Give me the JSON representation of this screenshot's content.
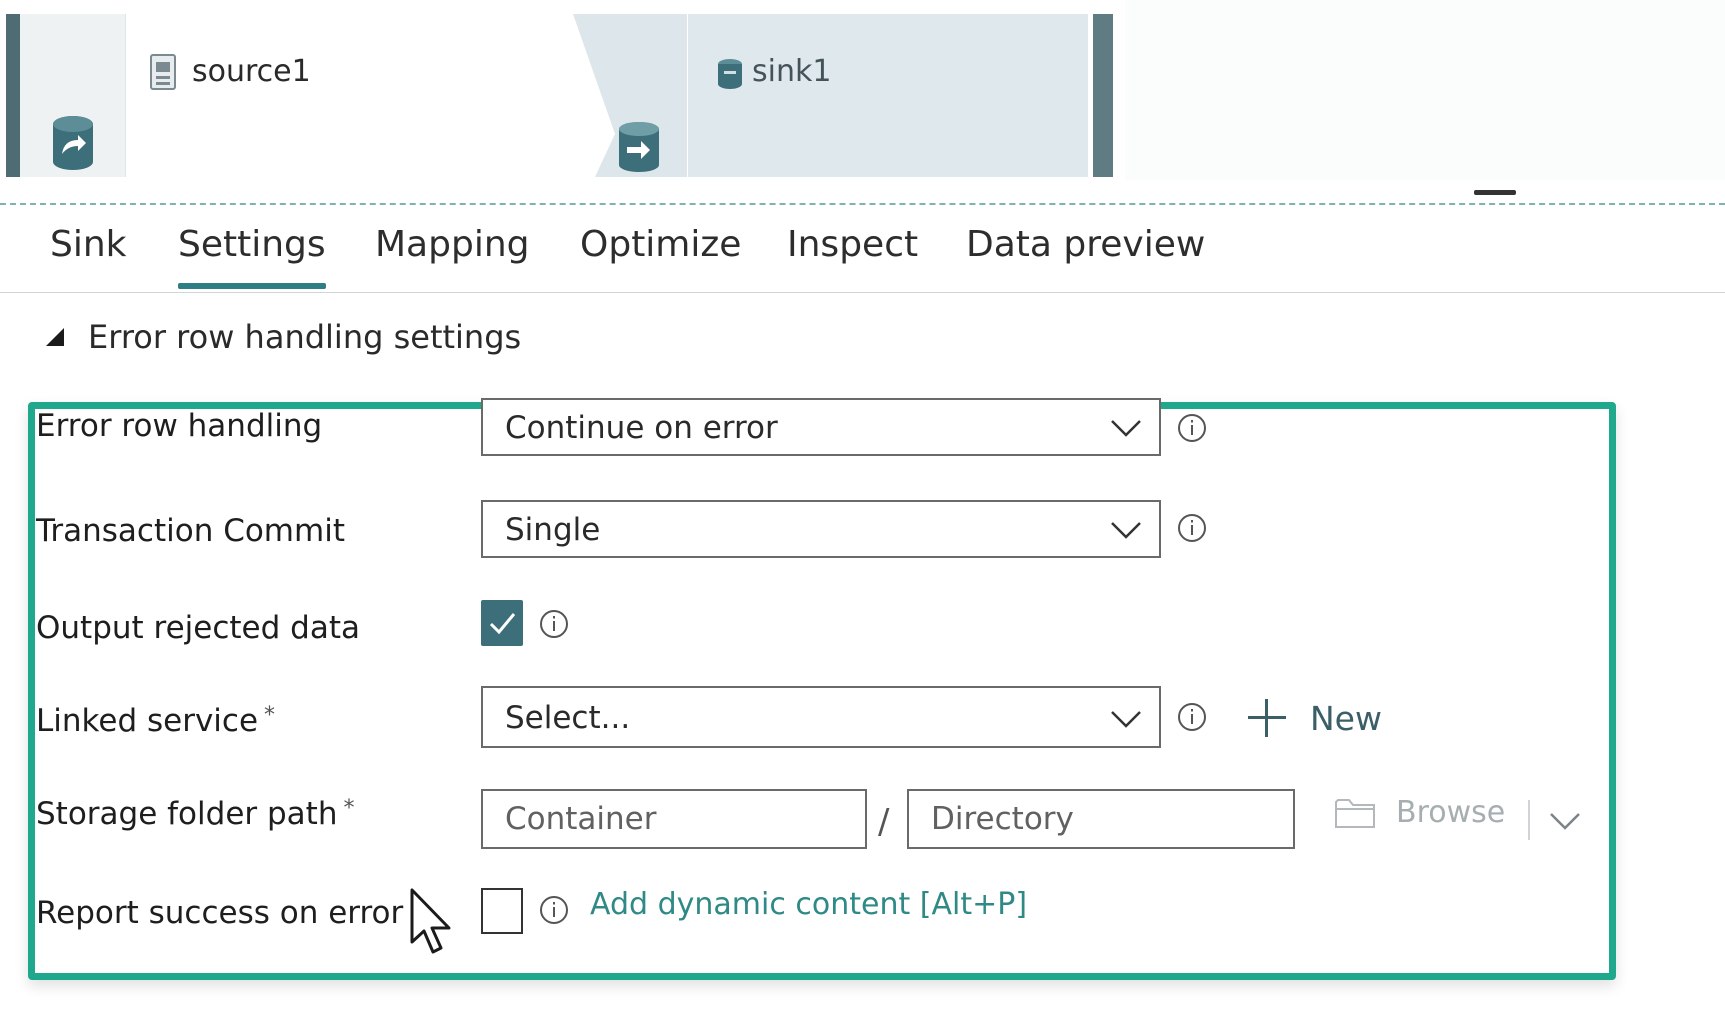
{
  "pipeline": {
    "source_node": {
      "label": "source1"
    },
    "sink_node": {
      "label": "sink1"
    }
  },
  "tabs": [
    {
      "label": "Sink",
      "active": false
    },
    {
      "label": "Settings",
      "active": true
    },
    {
      "label": "Mapping",
      "active": false
    },
    {
      "label": "Optimize",
      "active": false
    },
    {
      "label": "Inspect",
      "active": false
    },
    {
      "label": "Data preview",
      "active": false
    }
  ],
  "section": {
    "title": "Error row handling settings",
    "expanded": true
  },
  "form": {
    "error_row_handling": {
      "label": "Error row handling",
      "value": "Continue on error"
    },
    "transaction_commit": {
      "label": "Transaction Commit",
      "value": "Single"
    },
    "output_rejected_data": {
      "label": "Output rejected data",
      "checked": true
    },
    "linked_service": {
      "label": "Linked service",
      "required_mark": "*",
      "placeholder": "Select...",
      "new_label": "New"
    },
    "storage_folder_path": {
      "label": "Storage folder path",
      "required_mark": "*",
      "container_placeholder": "Container",
      "separator": "/",
      "directory_placeholder": "Directory",
      "browse_label": "Browse"
    },
    "report_success_on_error": {
      "label": "Report success on error",
      "checked": false,
      "dynamic_content_link": "Add dynamic content [Alt+P]"
    }
  },
  "colors": {
    "accent_teal": "#1fa88c",
    "tab_underline": "#2f7d85",
    "checkbox_fill": "#3d6f7a",
    "link": "#2f8a86"
  },
  "icons": {
    "source_node": "dataset-icon",
    "sink_node": "database-icon",
    "info": "info-icon",
    "add": "plus-icon",
    "browse": "folder-icon",
    "dropdown": "chevron-down-icon"
  }
}
